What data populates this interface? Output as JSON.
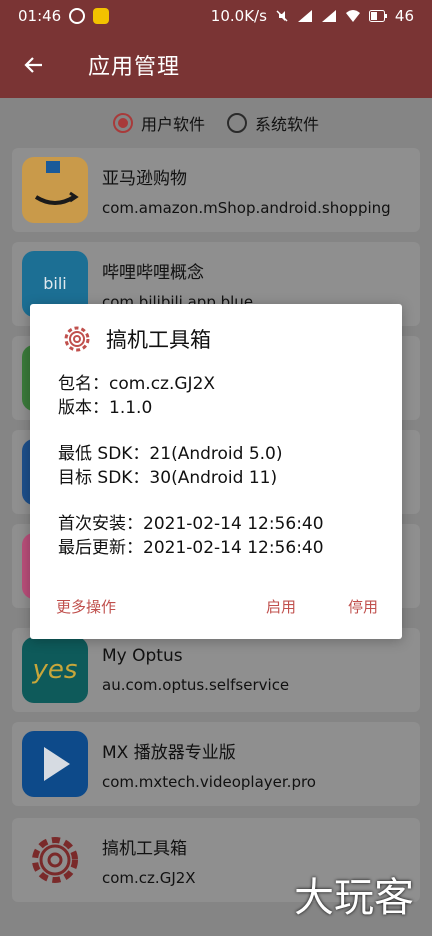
{
  "status": {
    "time": "01:46",
    "network_speed": "10.0K/s",
    "battery": "46"
  },
  "appbar": {
    "title": "应用管理",
    "back_icon": "back-arrow-icon"
  },
  "filters": [
    {
      "label": "用户软件",
      "checked": true
    },
    {
      "label": "系统软件",
      "checked": false
    }
  ],
  "apps": [
    {
      "name": "亚马逊购物",
      "pkg": "com.amazon.mShop.android.shopping",
      "icon": "amazon-icon"
    },
    {
      "name": "哔哩哔哩概念",
      "pkg": "com.bilibili.app.blue",
      "icon": "bilibili-icon"
    },
    {
      "name": "",
      "pkg": "",
      "icon": "green-app-icon"
    },
    {
      "name": "",
      "pkg": "",
      "icon": "blue-app-icon"
    },
    {
      "name": "",
      "pkg": "",
      "icon": "pink-app-icon"
    },
    {
      "name": "My Optus",
      "pkg": "au.com.optus.selfservice",
      "icon": "optus-icon"
    },
    {
      "name": "MX 播放器专业版",
      "pkg": "com.mxtech.videoplayer.pro",
      "icon": "mx-player-icon"
    },
    {
      "name": "搞机工具箱",
      "pkg": "com.cz.GJ2X",
      "icon": "gear-icon"
    }
  ],
  "dialog": {
    "title": "搞机工具箱",
    "package_line": "包名：com.cz.GJ2X",
    "version_line": "版本：1.1.0",
    "min_sdk_line": "最低 SDK：21(Android 5.0)",
    "target_sdk_line": "目标 SDK：30(Android 11)",
    "first_install_line": "首次安装：2021-02-14 12:56:40",
    "last_update_line": "最后更新：2021-02-14 12:56:40",
    "actions": {
      "more": "更多操作",
      "enable": "启用",
      "disable": "停用"
    }
  },
  "watermark": "大玩客",
  "colors": {
    "appbar": "#7a3434",
    "accent": "#c0504d"
  }
}
